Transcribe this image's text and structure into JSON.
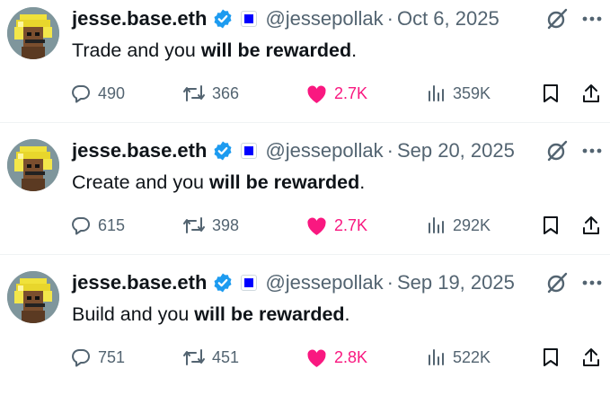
{
  "tweets": [
    {
      "name": "jesse.base.eth",
      "handle": "@jessepollak",
      "date": "Oct 6, 2025",
      "text_prefix": "Trade and you ",
      "text_bold": "will be rewarded",
      "text_suffix": ".",
      "replies": "490",
      "reposts": "366",
      "likes": "2.7K",
      "views": "359K"
    },
    {
      "name": "jesse.base.eth",
      "handle": "@jessepollak",
      "date": "Sep 20, 2025",
      "text_prefix": "Create and you ",
      "text_bold": "will be rewarded",
      "text_suffix": ".",
      "replies": "615",
      "reposts": "398",
      "likes": "2.7K",
      "views": "292K"
    },
    {
      "name": "jesse.base.eth",
      "handle": "@jessepollak",
      "date": "Sep 19, 2025",
      "text_prefix": "Build and you ",
      "text_bold": "will be rewarded",
      "text_suffix": ".",
      "replies": "751",
      "reposts": "451",
      "likes": "2.8K",
      "views": "522K"
    }
  ],
  "separator": "·",
  "icons": {
    "verified": "verified-badge-icon",
    "affiliate": "affiliate-square-icon",
    "grok": "grok-icon",
    "more": "more-dots-icon",
    "reply": "reply-bubble-icon",
    "repost": "repost-arrows-icon",
    "like": "heart-filled-icon",
    "views": "views-bars-icon",
    "bookmark": "bookmark-icon",
    "share": "share-upload-icon"
  },
  "colors": {
    "text": "#0f1419",
    "secondary": "#536471",
    "like": "#f91880",
    "verified": "#1d9bf0",
    "affiliate": "#0000ff",
    "divider": "#eff3f4"
  }
}
